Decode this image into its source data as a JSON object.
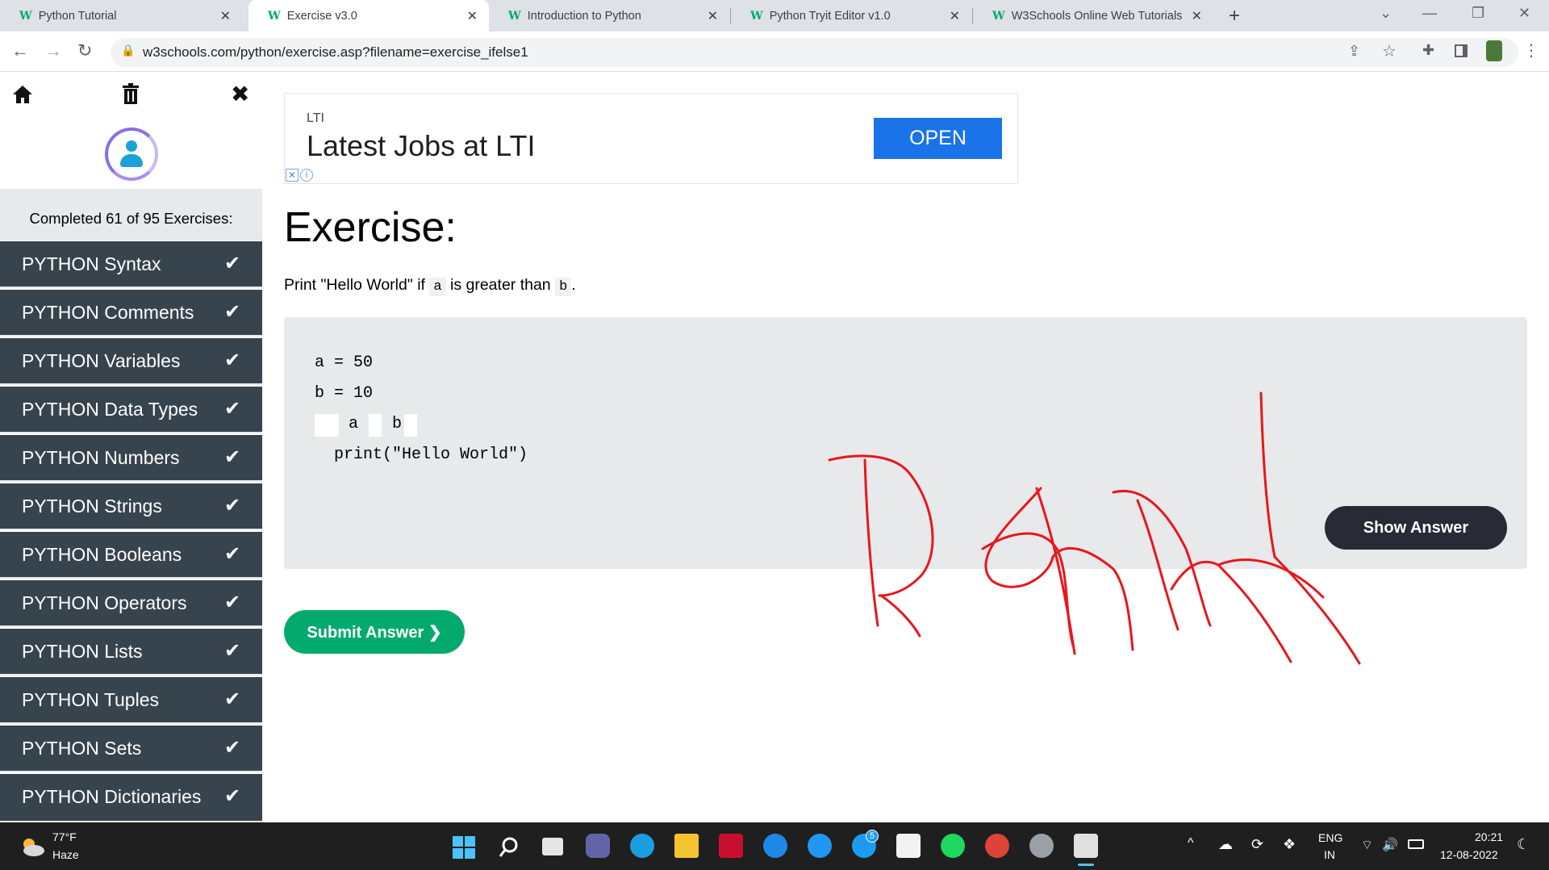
{
  "browser": {
    "tabs": [
      {
        "label": "Python Tutorial",
        "active": false
      },
      {
        "label": "Exercise v3.0",
        "active": true
      },
      {
        "label": "Introduction to Python",
        "active": false
      },
      {
        "label": "Python Tryit Editor v1.0",
        "active": false
      },
      {
        "label": "W3Schools Online Web Tutorials",
        "active": false
      }
    ],
    "favicon_glyph": "W",
    "url": "w3schools.com/python/exercise.asp?filename=exercise_ifelse1"
  },
  "sidebar": {
    "completed_text": "Completed 61 of 95 Exercises:",
    "items": [
      {
        "label": "PYTHON Syntax"
      },
      {
        "label": "PYTHON Comments"
      },
      {
        "label": "PYTHON Variables"
      },
      {
        "label": "PYTHON Data Types"
      },
      {
        "label": "PYTHON Numbers"
      },
      {
        "label": "PYTHON Strings"
      },
      {
        "label": "PYTHON Booleans"
      },
      {
        "label": "PYTHON Operators"
      },
      {
        "label": "PYTHON Lists"
      },
      {
        "label": "PYTHON Tuples"
      },
      {
        "label": "PYTHON Sets"
      },
      {
        "label": "PYTHON Dictionaries"
      }
    ],
    "check_glyph": "✔"
  },
  "ad": {
    "brand": "LTI",
    "title": "Latest Jobs at LTI",
    "button": "OPEN"
  },
  "exercise": {
    "title": "Exercise:",
    "desc_prefix": "Print \"Hello World\" if",
    "desc_var_a": "a",
    "desc_middle": "is greater than",
    "desc_var_b": "b",
    "desc_suffix": ".",
    "code": {
      "line1": "a = 50",
      "line2": "b = 10",
      "line3_a": "a",
      "line3_b": "b",
      "line4": "print(\"Hello World\")"
    },
    "show_answer": "Show Answer",
    "submit": "Submit Answer ❯"
  },
  "taskbar": {
    "weather_temp": "77°F",
    "weather_cond": "Haze",
    "lang_top": "ENG",
    "lang_bottom": "IN",
    "time": "20:21",
    "date": "12-08-2022",
    "twitter_badge": "5"
  },
  "colors": {
    "accent_green": "#04aa6d",
    "sidebar_dark": "#38444d",
    "button_dark": "#282a35",
    "ad_blue": "#1a73e8",
    "annotation_red": "#e8161c"
  }
}
